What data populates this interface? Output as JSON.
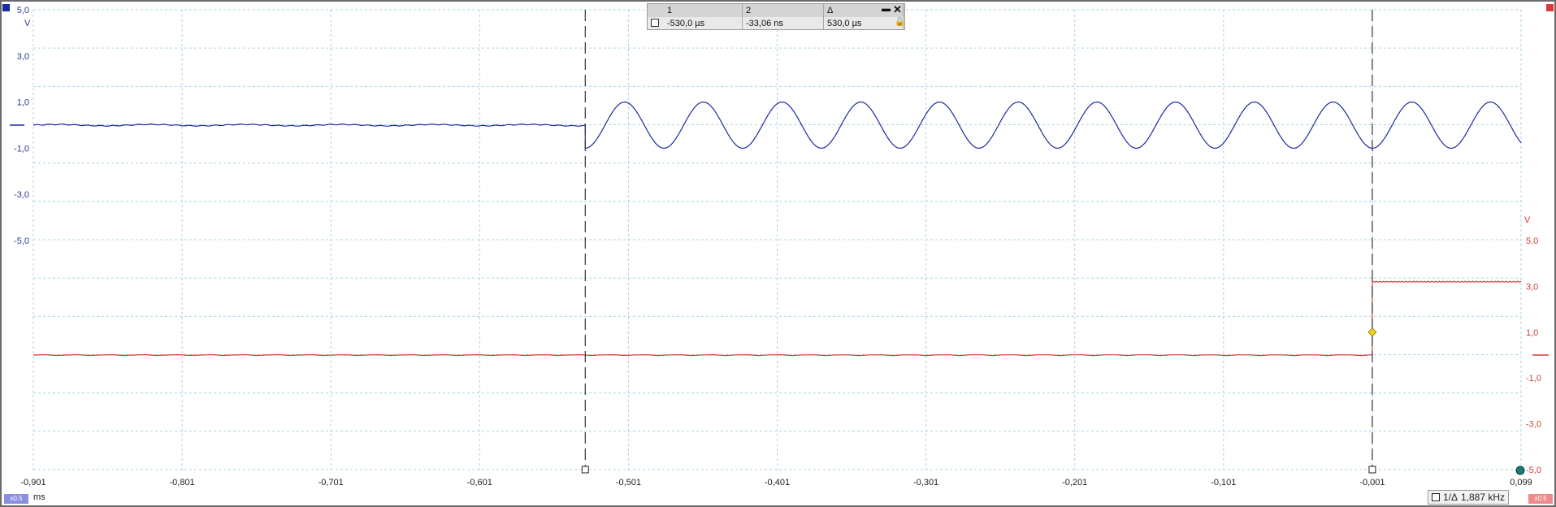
{
  "channel_a": {
    "unit": "V",
    "color": "#1c2a9e",
    "scale_tag": "x0.5",
    "y_ticks": [
      "5,0",
      "3,0",
      "1,0",
      "-1,0",
      "-3,0",
      "-5,0"
    ]
  },
  "channel_b": {
    "unit": "V",
    "color": "#d93a3a",
    "scale_tag": "x0.5",
    "y_ticks": [
      "5,0",
      "3,0",
      "1,0",
      "-1,0",
      "-3,0",
      "-5,0"
    ]
  },
  "x_axis": {
    "unit": "ms",
    "ticks": [
      "-0,901",
      "-0,801",
      "-0,701",
      "-0,601",
      "-0,501",
      "-0,401",
      "-0,301",
      "-0,201",
      "-0,101",
      "-0,001",
      "0,099"
    ]
  },
  "cursor_table": {
    "headers": [
      "1",
      "2",
      "Δ"
    ],
    "values": [
      "-530,0 µs",
      "-33,06 ns",
      "530,0 µs"
    ]
  },
  "frequency_readout": "1,887 kHz",
  "chart_data": {
    "type": "line",
    "x_range_ms": [
      -0.901,
      0.099
    ],
    "series": [
      {
        "trace": "A",
        "segments": [
          {
            "x": [
              -0.901,
              -0.53
            ],
            "kind": "flat",
            "level_V": 0.0
          },
          {
            "x": [
              -0.53,
              0.099
            ],
            "kind": "sine",
            "frequency_kHz": 18.9,
            "offset_V": 0.0,
            "amplitude_V": 1.0
          }
        ]
      },
      {
        "trace": "B",
        "segments": [
          {
            "x": [
              -0.901,
              -0.001
            ],
            "kind": "flat",
            "level_V": 0.0
          },
          {
            "x": [
              -0.001,
              0.099
            ],
            "kind": "flat",
            "level_V": 3.2
          }
        ]
      }
    ],
    "cursors_ms": [
      -0.53,
      -0.001
    ],
    "trigger": {
      "x_ms": -0.001,
      "level_V": 1.0
    },
    "grid": true,
    "y_range_V": [
      -5,
      5
    ]
  }
}
